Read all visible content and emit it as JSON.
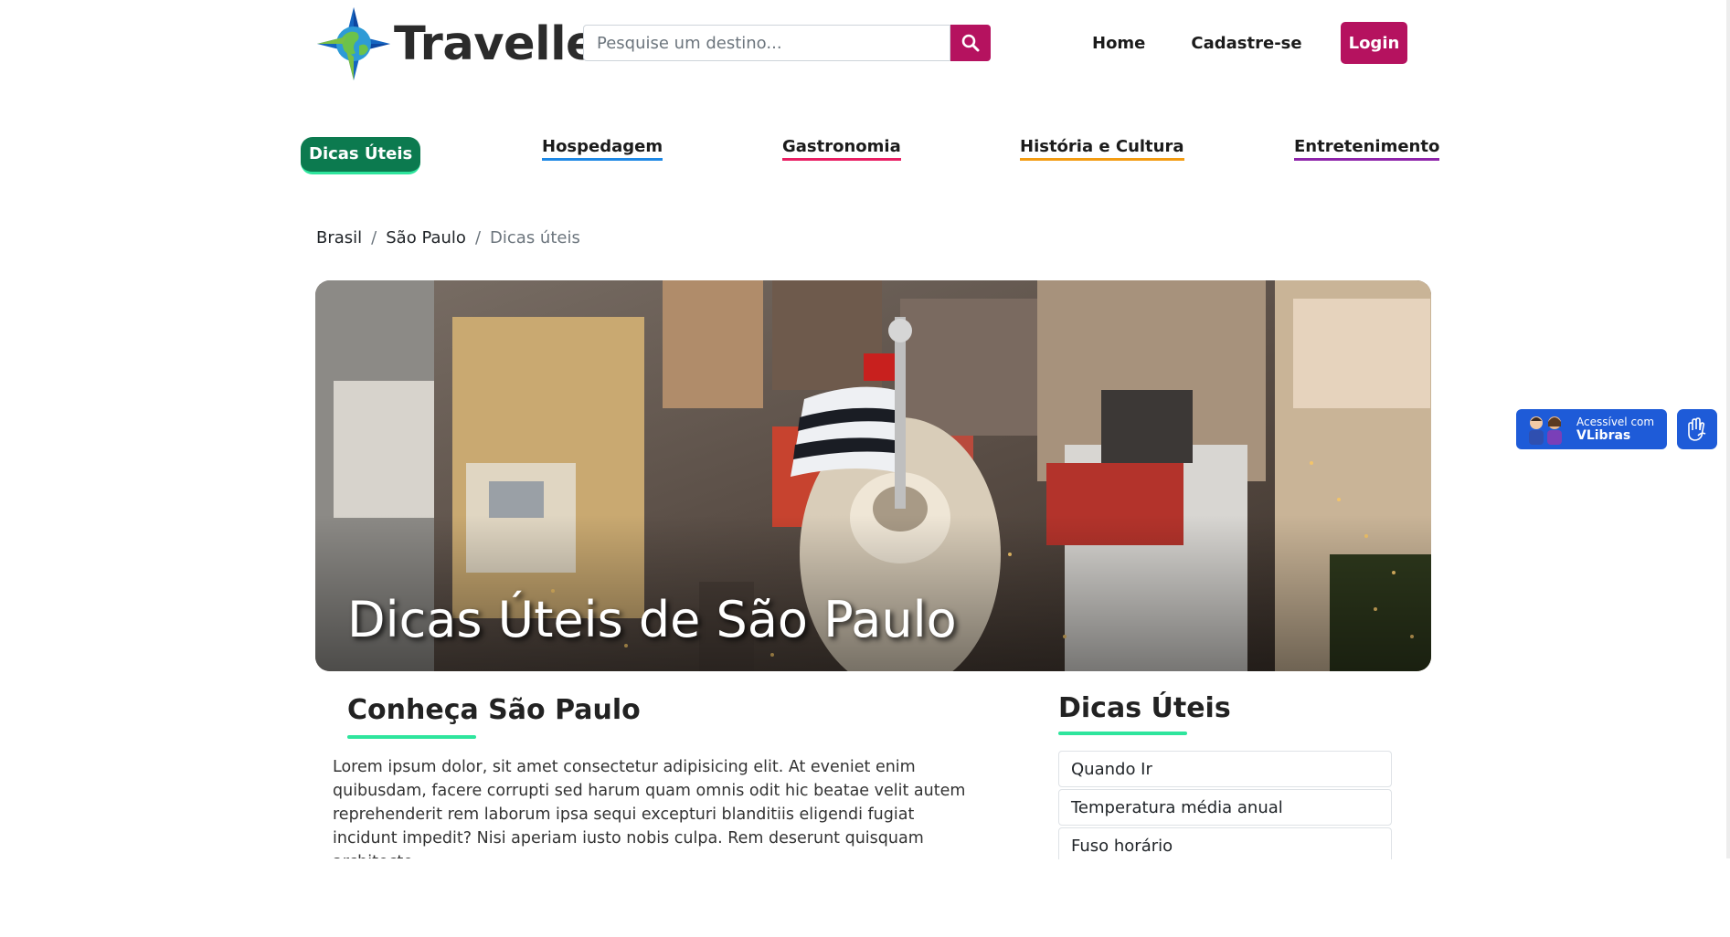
{
  "header": {
    "logo_text": "Traveller",
    "search_placeholder": "Pesquise um destino...",
    "nav": {
      "home": "Home",
      "signup": "Cadastre-se",
      "login": "Login"
    }
  },
  "categories": {
    "tips": "Dicas Úteis",
    "lodging": "Hospedagem",
    "gastronomy": "Gastronomia",
    "history": "História e Cultura",
    "entertainment": "Entretenimento"
  },
  "breadcrumb": [
    "Brasil",
    "São Paulo",
    "Dicas úteis"
  ],
  "hero": {
    "title": "Dicas Úteis de São Paulo"
  },
  "main": {
    "title": "Conheça São Paulo",
    "text": "Lorem ipsum dolor, sit amet consectetur adipisicing elit. At eveniet enim quibusdam, facere corrupti sed harum quam omnis odit hic beatae velit autem reprehenderit rem laborum ipsa sequi excepturi blanditiis eligendi fugiat incidunt impedit? Nisi aperiam iusto nobis culpa. Rem deserunt quisquam architecto"
  },
  "sidebar": {
    "title": "Dicas Úteis",
    "items": [
      "Quando Ir",
      "Temperatura média anual",
      "Fuso horário"
    ]
  },
  "vlibras": {
    "line1": "Acessível com",
    "line2": "VLibras"
  },
  "colors": {
    "brand": "#b5125f",
    "active_green": "#0c7a4f",
    "accent_green": "#2ee59d"
  }
}
